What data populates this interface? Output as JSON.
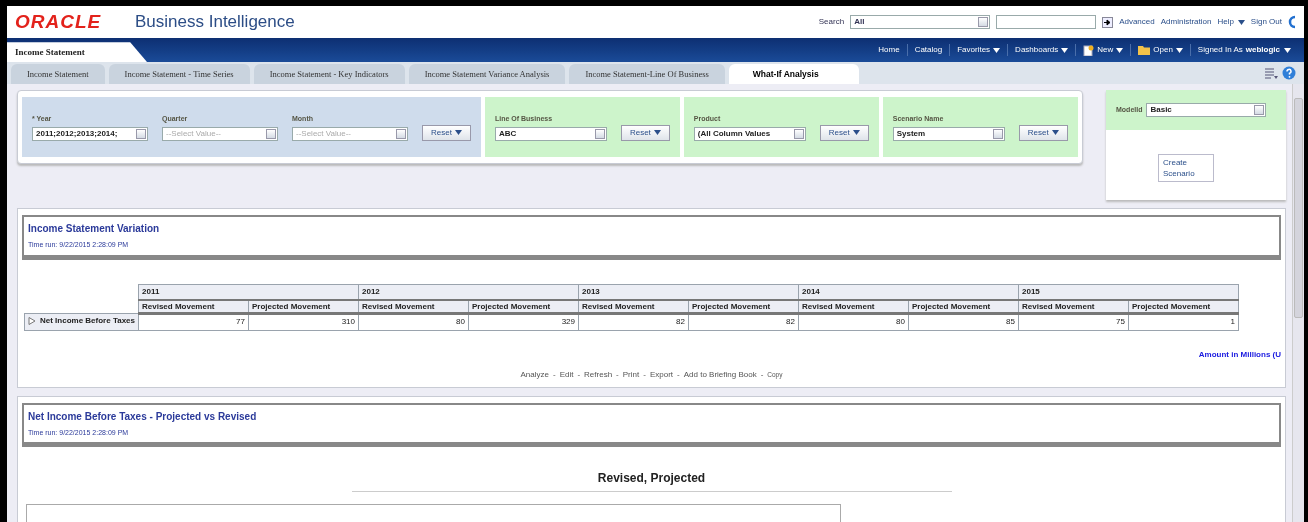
{
  "header": {
    "logo": "ORACLE",
    "product": "Business Intelligence",
    "search_label": "Search",
    "search_scope": "All",
    "links": [
      {
        "label": "Advanced",
        "menu": false
      },
      {
        "label": "Administration",
        "menu": false
      },
      {
        "label": "Help",
        "menu": true
      },
      {
        "label": "Sign Out",
        "menu": false
      }
    ]
  },
  "navbar": {
    "page_title": "Income Statement",
    "items": [
      {
        "label": "Home",
        "kind": "plain",
        "menu": false
      },
      {
        "label": "Catalog",
        "kind": "plain",
        "menu": false
      },
      {
        "label": "Favorites",
        "kind": "plain",
        "menu": true
      },
      {
        "label": "Dashboards",
        "kind": "plain",
        "menu": true
      },
      {
        "label": "New",
        "kind": "document",
        "menu": true
      },
      {
        "label": "Open",
        "kind": "folder",
        "menu": true
      }
    ],
    "signed_in": {
      "label": "Signed In As",
      "user": "weblogic"
    }
  },
  "tabs": [
    {
      "label": "Income Statement",
      "selected": false
    },
    {
      "label": "Income Statement - Time Series",
      "selected": false
    },
    {
      "label": "Income Statement - Key Indicators",
      "selected": false
    },
    {
      "label": "Income Statement Variance Analysis",
      "selected": false
    },
    {
      "label": "Income Statement-Line Of Business",
      "selected": false
    },
    {
      "label": "What-If Analysis",
      "selected": true
    }
  ],
  "prompts": [
    {
      "color": "#cfdcec",
      "fields": [
        {
          "label": "* Year",
          "value": "2011;2012;2013;2014;",
          "disabled": false
        },
        {
          "label": "Quarter",
          "value": "--Select Value--",
          "disabled": true
        },
        {
          "label": "Month",
          "value": "--Select Value--",
          "disabled": true
        }
      ],
      "reset": "Reset"
    },
    {
      "color": "#cdf4cb",
      "fields": [
        {
          "label": "Line Of Business",
          "value": "ABC",
          "disabled": false
        }
      ],
      "reset": "Reset"
    },
    {
      "color": "#cdf4cb",
      "fields": [
        {
          "label": "Product",
          "value": "(All Column Values",
          "disabled": false
        }
      ],
      "reset": "Reset"
    },
    {
      "color": "#cdf4cb",
      "fields": [
        {
          "label": "Scenario Name",
          "value": "System",
          "disabled": false
        }
      ],
      "reset": "Reset"
    }
  ],
  "model_panel": {
    "label": "ModelId",
    "value": "Basic",
    "link": "Create Scenario"
  },
  "sections": [
    {
      "title": "Income Statement Variation",
      "time_run": "Time run: 9/22/2015 2:28:09 PM",
      "table": {
        "columns": [
          {
            "year": "2011",
            "measures": [
              "Revised Movement",
              "Projected Movement"
            ]
          },
          {
            "year": "2012",
            "measures": [
              "Revised Movement",
              "Projected Movement"
            ]
          },
          {
            "year": "2013",
            "measures": [
              "Revised Movement",
              "Projected Movement"
            ]
          },
          {
            "year": "2014",
            "measures": [
              "Revised Movement",
              "Projected Movement"
            ]
          },
          {
            "year": "2015",
            "measures": [
              "Revised Movement",
              "Projected Movement"
            ]
          }
        ],
        "rows": [
          {
            "label": "Net Income Before Taxes",
            "expanded": false,
            "values": [
              "77",
              "310",
              "80",
              "329",
              "82",
              "82",
              "80",
              "85",
              "75",
              "1"
            ]
          }
        ]
      },
      "note": "Amount in Millions (U",
      "links": [
        {
          "kind": "link",
          "label": "Analyze"
        },
        {
          "kind": "sep",
          "label": "-"
        },
        {
          "kind": "link",
          "label": "Edit"
        },
        {
          "kind": "sep",
          "label": "-"
        },
        {
          "kind": "link",
          "label": "Refresh"
        },
        {
          "kind": "sep",
          "label": "-"
        },
        {
          "kind": "link",
          "label": "Print"
        },
        {
          "kind": "sep",
          "label": "-"
        },
        {
          "kind": "link",
          "label": "Export"
        },
        {
          "kind": "sep",
          "label": "-"
        },
        {
          "kind": "link",
          "label": "Add to Briefing Book"
        },
        {
          "kind": "sep",
          "label": "-"
        },
        {
          "kind": "small",
          "label": "Copy"
        }
      ]
    },
    {
      "title": "Net Income Before Taxes - Projected vs Revised",
      "time_run": "Time run: 9/22/2015 2:28:09 PM",
      "chart_title": "Revised, Projected"
    }
  ]
}
